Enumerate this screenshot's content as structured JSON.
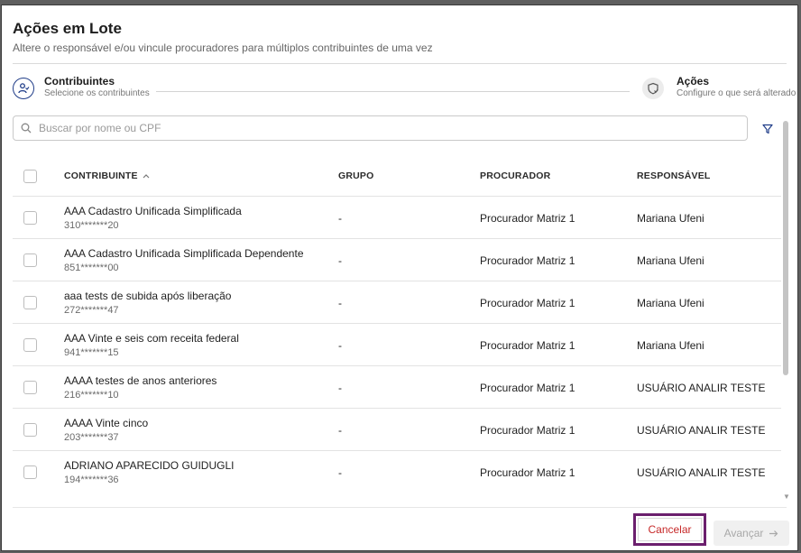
{
  "modal": {
    "title": "Ações em Lote",
    "subtitle": "Altere o responsável e/ou vincule procuradores para múltiplos contribuintes de uma vez"
  },
  "stepper": {
    "steps": [
      {
        "title": "Contribuintes",
        "description": "Selecione os contribuintes",
        "icon": "user-icon",
        "active": true
      },
      {
        "title": "Ações",
        "description": "Configure o que será alterado",
        "icon": "shield-check-icon",
        "active": false
      }
    ]
  },
  "search": {
    "placeholder": "Buscar por nome ou CPF",
    "value": ""
  },
  "table": {
    "headers": [
      "CONTRIBUINTE",
      "GRUPO",
      "PROCURADOR",
      "RESPONSÁVEL"
    ],
    "rows": [
      {
        "name": "AAA Cadastro Unificada Simplificada",
        "cpf": "310*******20",
        "grupo": "-",
        "procurador": "Procurador Matriz 1",
        "responsavel": "Mariana Ufeni"
      },
      {
        "name": "AAA Cadastro Unificada Simplificada Dependente",
        "cpf": "851*******00",
        "grupo": "-",
        "procurador": "Procurador Matriz 1",
        "responsavel": "Mariana Ufeni"
      },
      {
        "name": "aaa tests de subida após liberação",
        "cpf": "272*******47",
        "grupo": "-",
        "procurador": "Procurador Matriz 1",
        "responsavel": "Mariana Ufeni"
      },
      {
        "name": "AAA Vinte e seis com receita federal",
        "cpf": "941*******15",
        "grupo": "-",
        "procurador": "Procurador Matriz 1",
        "responsavel": "Mariana Ufeni"
      },
      {
        "name": "AAAA testes de anos anteriores",
        "cpf": "216*******10",
        "grupo": "-",
        "procurador": "Procurador Matriz 1",
        "responsavel": "USUÁRIO ANALIR TESTE"
      },
      {
        "name": "AAAA Vinte cinco",
        "cpf": "203*******37",
        "grupo": "-",
        "procurador": "Procurador Matriz 1",
        "responsavel": "USUÁRIO ANALIR TESTE"
      },
      {
        "name": "ADRIANO APARECIDO GUIDUGLI",
        "cpf": "194*******36",
        "grupo": "-",
        "procurador": "Procurador Matriz 1",
        "responsavel": "USUÁRIO ANALIR TESTE"
      }
    ]
  },
  "footer": {
    "cancel_label": "Cancelar",
    "next_label": "Avançar"
  },
  "colors": {
    "primary": "#1f3c88",
    "cancel_text": "#c62828",
    "highlight": "#6b1f6d"
  }
}
